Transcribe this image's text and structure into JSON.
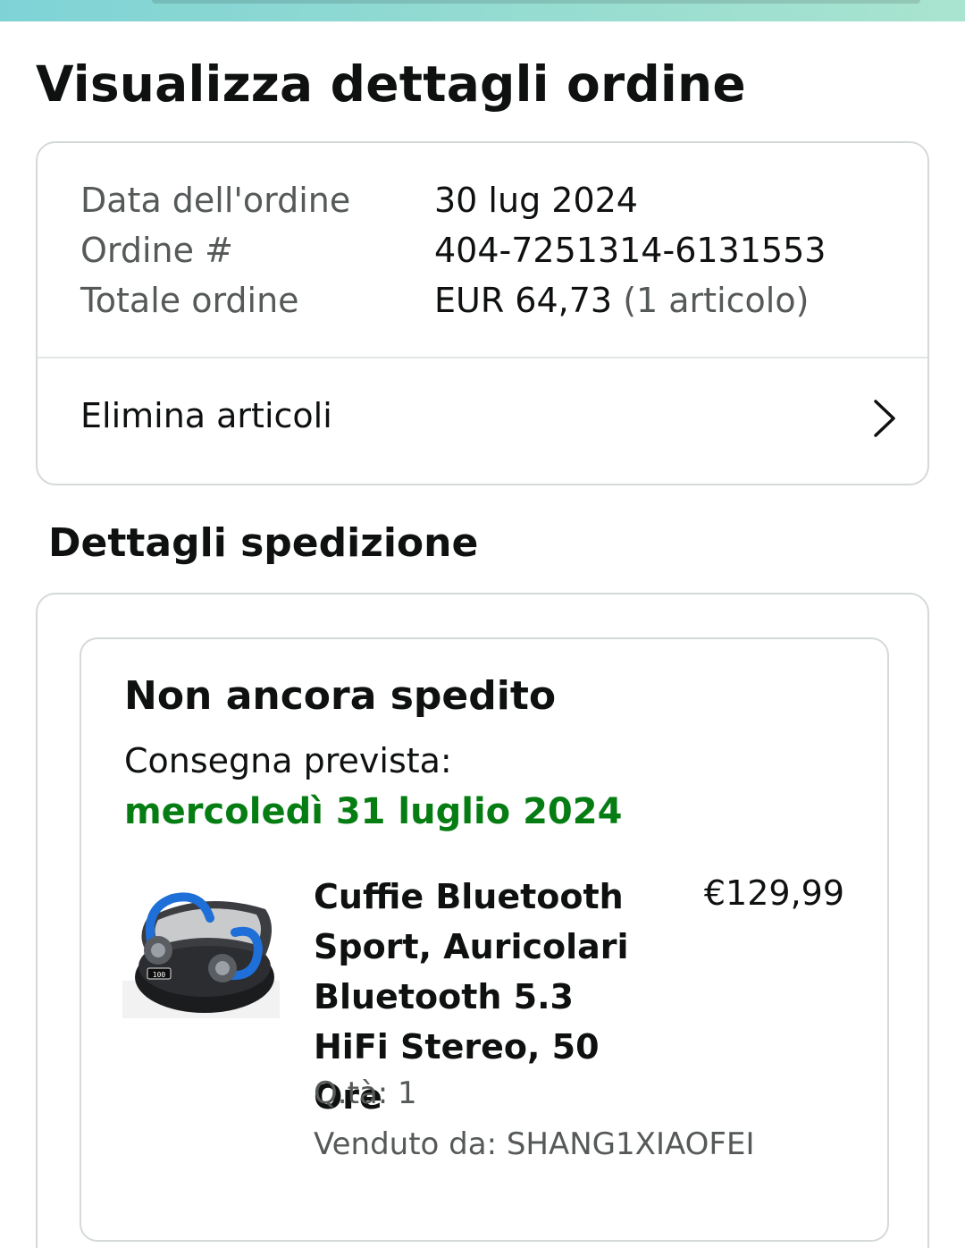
{
  "header": {
    "title": "Visualizza dettagli ordine"
  },
  "order_summary": {
    "date_label": "Data dell'ordine",
    "date_value": "30 lug 2024",
    "number_label": "Ordine #",
    "number_value": "404-7251314-6131553",
    "total_label": "Totale ordine",
    "total_value": "EUR 64,73",
    "total_items": "(1 articolo)",
    "action_label": "Elimina articoli",
    "action_icon": "chevron-right-icon"
  },
  "shipping": {
    "section_title": "Dettagli spedizione",
    "status": "Non ancora spedito",
    "delivery_label": "Consegna prevista:",
    "delivery_date": "mercoledì 31 luglio 2024",
    "delivery_date_color": "#067d13",
    "item": {
      "title": "Cuffie Bluetooth Sport, Auricolari Bluetooth 5.3 HiFi Stereo, 50 Ore",
      "price": "€129,99",
      "quantity": "Q.tà: 1",
      "seller": "Venduto da: SHANG1XIAOFEI",
      "image_icon": "earbuds-product-image",
      "image_display_text": "100"
    }
  }
}
